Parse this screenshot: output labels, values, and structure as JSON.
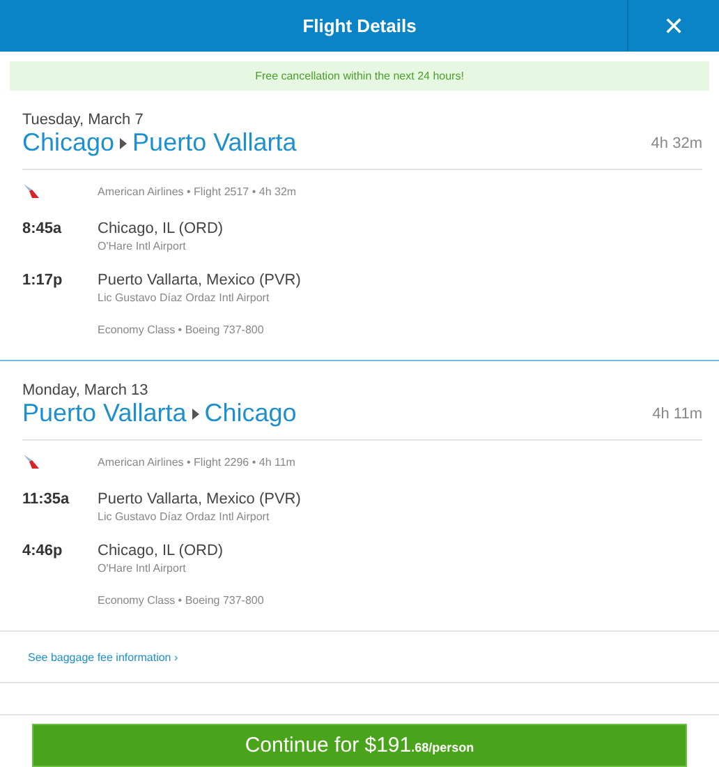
{
  "header": {
    "title": "Flight Details",
    "close": "✕"
  },
  "banner": "Free cancellation within the next 24 hours!",
  "legs": [
    {
      "date": "Tuesday, March 7",
      "origin": "Chicago",
      "destination": "Puerto Vallarta",
      "duration": "4h 32m",
      "flight_info": "American Airlines • Flight 2517 • 4h 32m",
      "stops": [
        {
          "time": "8:45a",
          "place": "Chicago, IL (ORD)",
          "airport": "O'Hare Intl Airport"
        },
        {
          "time": "1:17p",
          "place": "Puerto Vallarta, Mexico (PVR)",
          "airport": "Lic Gustavo Díaz Ordaz Intl Airport"
        }
      ],
      "cabin": "Economy Class • Boeing 737-800"
    },
    {
      "date": "Monday, March 13",
      "origin": "Puerto Vallarta",
      "destination": "Chicago",
      "duration": "4h 11m",
      "flight_info": "American Airlines • Flight 2296 • 4h 11m",
      "stops": [
        {
          "time": "11:35a",
          "place": "Puerto Vallarta, Mexico (PVR)",
          "airport": "Lic Gustavo Díaz Ordaz Intl Airport"
        },
        {
          "time": "4:46p",
          "place": "Chicago, IL (ORD)",
          "airport": "O'Hare Intl Airport"
        }
      ],
      "cabin": "Economy Class • Boeing 737-800"
    }
  ],
  "baggage_link": "See baggage fee information ›",
  "continue_button": {
    "label": "Continue for $191",
    "cents": ".68/person"
  }
}
